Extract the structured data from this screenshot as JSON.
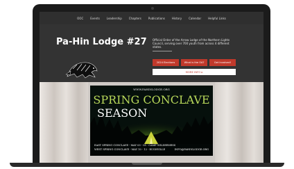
{
  "nav": {
    "items": [
      "OOC",
      "Events",
      "Leadership",
      "Chapters",
      "Publications",
      "History",
      "Calendar",
      "Helpful Links"
    ]
  },
  "header": {
    "site_title": "Pa-Hin Lodge #27",
    "intro_text": "Official Order of the Arrow Lodge of the Northern Lights Council, serving over 700 youth from across 4 different states.",
    "buttons": [
      "2024 Elections",
      "What is the OA?",
      "Get Involved!"
    ],
    "white_button": "MORE INFO ▸"
  },
  "poster": {
    "url": "WWW.PAHINLODGE.ORG",
    "title_line1": "SPRING CONCLAVE",
    "title_line2": "SEASON",
    "line1": "EAST SPRING CONCLAVE - MAY 03 - 05 - CAMP WILDERNESS",
    "line2": "WEST SPRING CONCLAVE - MAY 10 - 12 - RUSHVILLE",
    "email": "INFO@PAHINLODGE.ORG"
  },
  "colors": {
    "accent": "#c0392b",
    "header_bg": "#333333",
    "title_green": "#b8d85a"
  }
}
